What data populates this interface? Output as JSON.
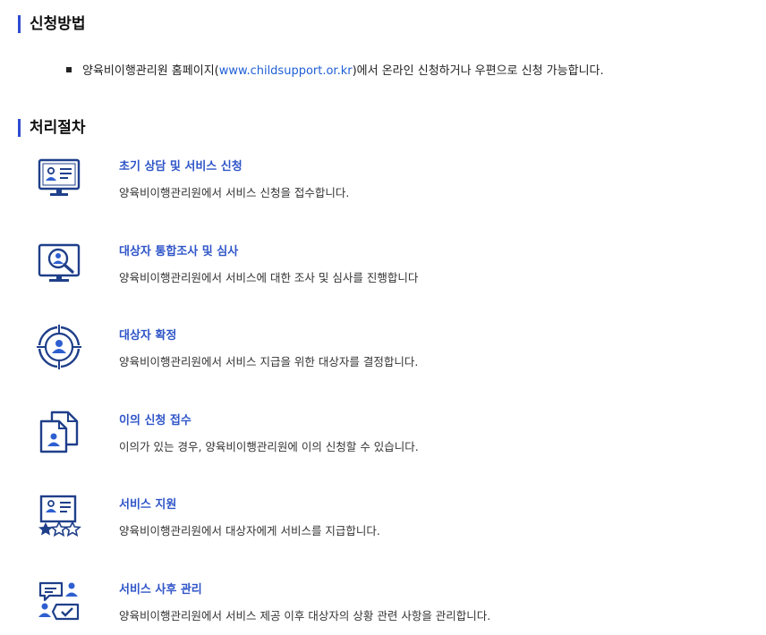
{
  "sections": {
    "method_title": "신청방법",
    "process_title": "처리절차"
  },
  "method": {
    "text_before": "양육비이행관리원 홈페이지(",
    "link": "www.childsupport.or.kr",
    "text_after": ")에서 온라인 신청하거나 우편으로 신청 가능합니다."
  },
  "steps": [
    {
      "title": "초기 상담 및 서비스 신청",
      "desc": "양육비이행관리원에서 서비스 신청을 접수합니다.",
      "icon": "monitor-profile-icon"
    },
    {
      "title": "대상자 통합조사 및 심사",
      "desc": "양육비이행관리원에서 서비스에 대한 조사 및 심사를 진행합니다",
      "icon": "monitor-search-person-icon"
    },
    {
      "title": "대상자 확정",
      "desc": "양육비이행관리원에서 서비스 지급을 위한 대상자를 결정합니다.",
      "icon": "target-person-icon"
    },
    {
      "title": "이의 신청 접수",
      "desc": "이의가 있는 경우, 양육비이행관리원에 이의 신청할 수 있습니다.",
      "icon": "documents-person-icon"
    },
    {
      "title": "서비스 지원",
      "desc": "양육비이행관리원에서 대상자에게 서비스를 지급합니다.",
      "icon": "profile-stars-icon"
    },
    {
      "title": "서비스 사후 관리",
      "desc": "양육비이행관리원에서 서비스 제공 이후 대상자의 상황 관련 사항을 관리합니다.",
      "icon": "chat-check-people-icon"
    }
  ],
  "colors": {
    "accent": "#2e4bd0",
    "icon_blue": "#1f3f8a",
    "step_title": "#2f55c8",
    "link": "#1f5fd6"
  }
}
